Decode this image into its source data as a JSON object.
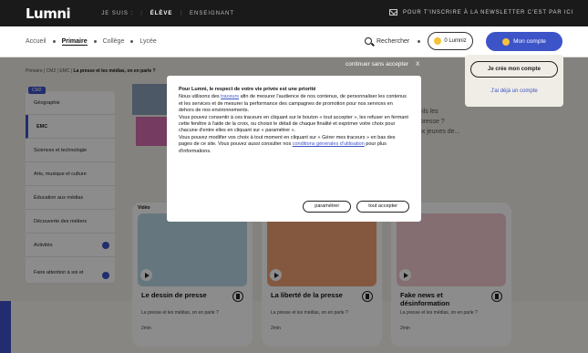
{
  "topbar": {
    "logo": "Lumni",
    "nav": [
      "JE SUIS :",
      "ÉLÈVE",
      "ENSEIGNANT"
    ],
    "newsletter": "POUR T'INSCRIRE À LA NEWSLETTER C'EST PAR ICI"
  },
  "levels": [
    "Accueil",
    "Primaire",
    "Collège",
    "Lycée"
  ],
  "search_label": "Rechercher",
  "lumniz_label": "0 Lumniz",
  "account_label": "Mon compte",
  "account_menu": {
    "create": "Je crée mon compte",
    "login": "J'ai déjà un compte"
  },
  "breadcrumb": {
    "prefix": "Primaire | CM2 | EMC | ",
    "current": "La presse et les médias, on en parle ?"
  },
  "sidebar": {
    "badge": "CM2",
    "items": [
      "Géographie",
      "EMC",
      "Sciences et technologie",
      "Arts, musique et culture",
      "Éducation aux médias",
      "Découverte des métiers",
      "Activités",
      "Faire attention à soi et"
    ]
  },
  "hero_text": [
    "nt-ils les",
    "e presse ?",
    "aux jeunes de..."
  ],
  "cards": [
    {
      "tag": "Vidéo",
      "title": "Le dessin de presse",
      "subtitle": "La presse et les médias, on en parle ?",
      "duration": "2min",
      "color": "#b9d7e6"
    },
    {
      "tag": "",
      "title": "La liberté de la presse",
      "subtitle": "La presse et les médias, on en parle ?",
      "duration": "2min",
      "color": "#f0a173"
    },
    {
      "tag": "",
      "title": "Fake news et désinformation",
      "subtitle": "La presse et les médias, on en parle ?",
      "duration": "2min",
      "color": "#f1c9cf"
    }
  ],
  "consent": {
    "continue": "continuer sans accepter",
    "close": "X",
    "title": "Pour Lumni, le respect de votre vie privée est une priorité",
    "p1a": "Nous utilisons des ",
    "p1link": "traceurs",
    "p1b": " afin de mesurer l'audience de nos contenus, de personnaliser les contenus et les services et de mesurer la performance des campagnes de promotion pour nos services en dehors de nos environnements.",
    "p2": "Vous pouvez consentir à ces traceurs en cliquant sur le bouton « tout accepter », les refuser en fermant cette fenêtre à l'aide de la croix, ou choisir le détail de chaque finalité et exprimer votre choix pour chacune d'entre elles en cliquant sur « paramétrer ».",
    "p3a": "Vous pouvez modifier vos choix à tout moment en cliquant sur « Gérer mes traceurs » en bas des pages de ce site. Vous pouvez aussi consulter nos ",
    "p3link": "conditions générales d'utilisation",
    "p3b": " pour plus d'informations.",
    "btn_settings": "paramétrer",
    "btn_accept": "tout accepter"
  }
}
